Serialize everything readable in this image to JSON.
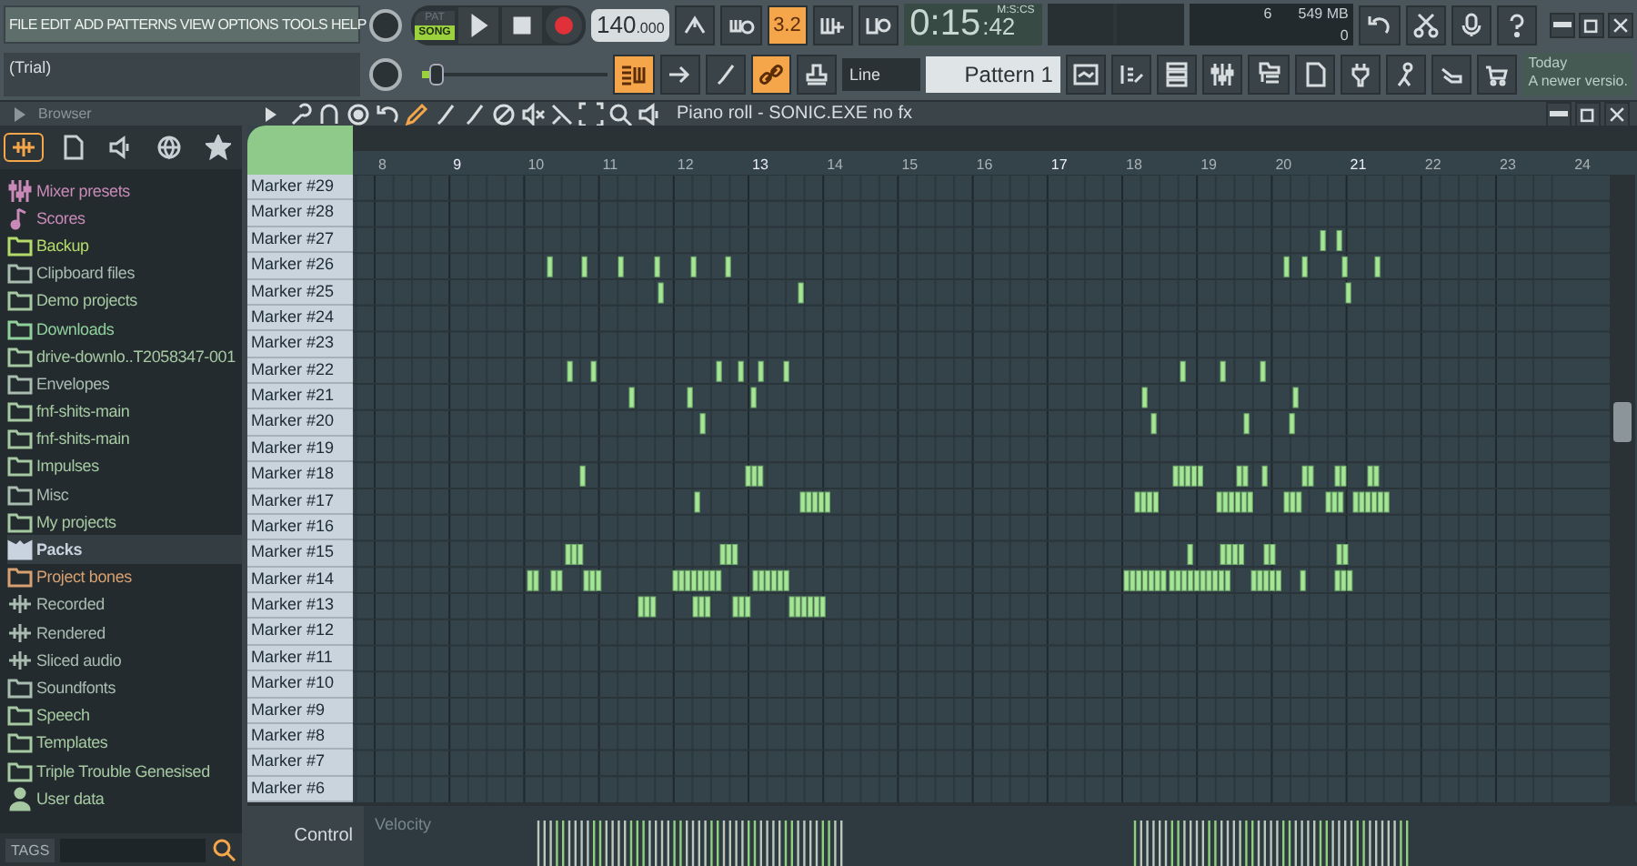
{
  "menu": [
    "FILE",
    "EDIT",
    "ADD",
    "PATTERNS",
    "VIEW",
    "OPTIONS",
    "TOOLS",
    "HELP"
  ],
  "hint_bar": {
    "text": "(Trial)"
  },
  "transport": {
    "modes": [
      {
        "label": "PAT",
        "selected": false
      },
      {
        "label": "SONG",
        "selected": true
      }
    ]
  },
  "tempo": {
    "whole": "140",
    "fraction": ".000"
  },
  "time": {
    "main": "0:15",
    "small": ":42",
    "unit": "M:S:CS"
  },
  "cpu": {
    "polyphony": "6",
    "memory": "549 MB",
    "value": "0"
  },
  "top_tools": [
    {
      "kind": "tuner",
      "on": false
    },
    {
      "kind": "wait",
      "on": false
    },
    {
      "kind": "count",
      "label": "3.2",
      "on": true
    },
    {
      "kind": "keys",
      "on": false
    },
    {
      "kind": "loop",
      "on": false
    }
  ],
  "master_pitch": {
    "level": 0.08
  },
  "edit_tools": [
    {
      "kind": "roll",
      "on": true
    },
    {
      "kind": "arrow",
      "on": false
    },
    {
      "kind": "brush",
      "on": false
    },
    {
      "kind": "link",
      "on": true
    },
    {
      "kind": "stamp",
      "on": false
    }
  ],
  "snap": {
    "value": "Line"
  },
  "pattern": {
    "value": "Pattern 1"
  },
  "news": {
    "title": "Today",
    "text": "A newer versio."
  },
  "browser": {
    "title": "Browser",
    "tabs": [
      {
        "kind": "audio",
        "selected": true
      },
      {
        "kind": "file",
        "selected": false
      },
      {
        "kind": "speaker",
        "selected": false
      },
      {
        "kind": "globe",
        "selected": false
      },
      {
        "kind": "star",
        "selected": false
      }
    ],
    "items": [
      {
        "label": "Mixer presets",
        "kind": "mixer",
        "color": "#c98ab8",
        "selected": false
      },
      {
        "label": "Scores",
        "kind": "note",
        "color": "#c98ab8",
        "selected": false
      },
      {
        "label": "Backup",
        "kind": "folder",
        "color": "#b5dc6a",
        "selected": false
      },
      {
        "label": "Clipboard files",
        "kind": "folder",
        "color": "#a9bcb0",
        "selected": false
      },
      {
        "label": "Demo projects",
        "kind": "folder",
        "color": "#a6c9a2",
        "selected": false
      },
      {
        "label": "Downloads",
        "kind": "folder",
        "color": "#8fd09c",
        "selected": false
      },
      {
        "label": "drive-downlo..T2058347-001",
        "kind": "folder",
        "color": "#a6c9a2",
        "selected": false
      },
      {
        "label": "Envelopes",
        "kind": "folder",
        "color": "#a9bcb0",
        "selected": false
      },
      {
        "label": "fnf-shits-main",
        "kind": "folder",
        "color": "#a6c9a2",
        "selected": false
      },
      {
        "label": "fnf-shits-main",
        "kind": "folder",
        "color": "#a6c9a2",
        "selected": false
      },
      {
        "label": "Impulses",
        "kind": "folder",
        "color": "#a6c9a2",
        "selected": false
      },
      {
        "label": "Misc",
        "kind": "folder",
        "color": "#a9bcb0",
        "selected": false
      },
      {
        "label": "My projects",
        "kind": "folder",
        "color": "#a6c9a2",
        "selected": false
      },
      {
        "label": "Packs",
        "kind": "pack",
        "color": "#c8d3df",
        "selected": true
      },
      {
        "label": "Project bones",
        "kind": "folder",
        "color": "#d8a070",
        "selected": false
      },
      {
        "label": "Recorded",
        "kind": "audio",
        "color": "#a9bcb0",
        "selected": false
      },
      {
        "label": "Rendered",
        "kind": "audio",
        "color": "#a9bcb0",
        "selected": false
      },
      {
        "label": "Sliced audio",
        "kind": "audio",
        "color": "#a9bcb0",
        "selected": false
      },
      {
        "label": "Soundfonts",
        "kind": "folder",
        "color": "#a9bcb0",
        "selected": false
      },
      {
        "label": "Speech",
        "kind": "folder",
        "color": "#a6c9a2",
        "selected": false
      },
      {
        "label": "Templates",
        "kind": "folder",
        "color": "#a6c9a2",
        "selected": false
      },
      {
        "label": "Triple Trouble Genesised",
        "kind": "folder",
        "color": "#a6c9a2",
        "selected": false
      },
      {
        "label": "User data",
        "kind": "user",
        "color": "#a6c9a2",
        "selected": false
      }
    ],
    "tags_label": "TAGS"
  },
  "piano_roll": {
    "title": "Piano roll - SONIC.EXE no fx",
    "bars": [
      "8",
      "9",
      "10",
      "11",
      "12",
      "13",
      "14",
      "15",
      "16",
      "17",
      "18",
      "19",
      "20",
      "21",
      "22",
      "23",
      "24"
    ],
    "keys": [
      "Marker #29",
      "Marker #28",
      "Marker #27",
      "Marker #26",
      "Marker #25",
      "Marker #24",
      "Marker #23",
      "Marker #22",
      "Marker #21",
      "Marker #20",
      "Marker #19",
      "Marker #18",
      "Marker #17",
      "Marker #16",
      "Marker #15",
      "Marker #14",
      "Marker #13",
      "Marker #12",
      "Marker #11",
      "Marker #10",
      "Marker #9",
      "Marker #8",
      "Marker #7",
      "Marker #6"
    ],
    "control": {
      "label": "Control",
      "target": "Velocity"
    }
  }
}
